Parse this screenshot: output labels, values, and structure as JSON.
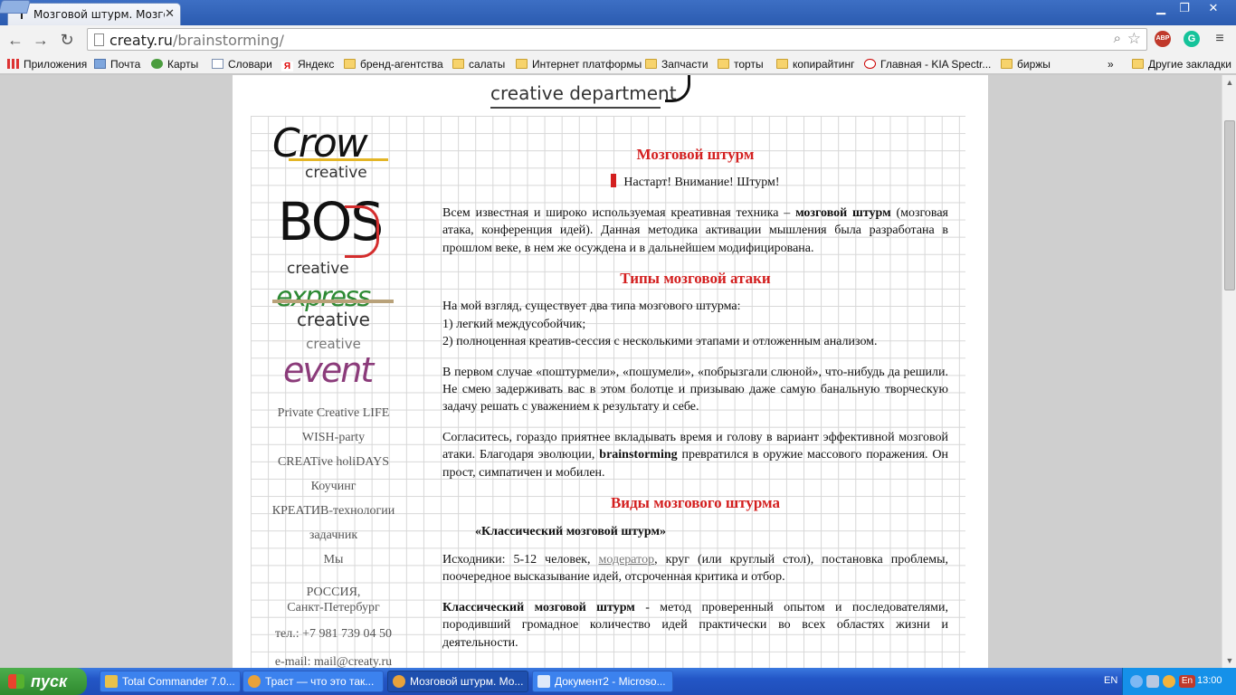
{
  "browser": {
    "tab_title": "Мозговой штурм. Мозговая",
    "url_host": "creaty.ru",
    "url_path": "/brainstorming/",
    "ext_abp": "ABP",
    "ext_grammarly": "G"
  },
  "bookmarks": [
    {
      "label": "Приложения",
      "icon": "apps-icon"
    },
    {
      "label": "Почта",
      "icon": "mail-icon"
    },
    {
      "label": "Карты",
      "icon": "maps-icon"
    },
    {
      "label": "Словари",
      "icon": "dictionary-icon"
    },
    {
      "label": "Яндекс",
      "icon": "yandex-icon"
    },
    {
      "label": "бренд-агентства",
      "icon": "folder-icon"
    },
    {
      "label": "салаты",
      "icon": "folder-icon"
    },
    {
      "label": "Интернет платформы",
      "icon": "folder-icon"
    },
    {
      "label": "Запчасти",
      "icon": "folder-icon"
    },
    {
      "label": "торты",
      "icon": "folder-icon"
    },
    {
      "label": "копирайтинг",
      "icon": "folder-icon"
    },
    {
      "label": "Главная - KIA Spectr...",
      "icon": "kia-icon"
    },
    {
      "label": "биржы",
      "icon": "folder-icon"
    }
  ],
  "bookmarks_more": "»",
  "bookmarks_other": "Другие закладки",
  "site": {
    "header_text": "creative department",
    "logos": {
      "crow_big": "Crow",
      "crow_small": "creative",
      "bos_big": "BOS",
      "bos_small": "creative",
      "express_big": "express",
      "express_small": "creative",
      "event_small": "creative",
      "event_big": "event"
    },
    "menu": [
      "Private Creative LIFE",
      "WISH-party",
      "CREATive holiDAYS",
      "Коучинг",
      "КРЕАТИВ-технологии",
      "задачник",
      "Мы"
    ],
    "country": "РОССИЯ,",
    "city": "Санкт-Петербург",
    "phone": "тел.: +7 981 739 04 50",
    "email": "e-mail: mail@creaty.ru"
  },
  "article": {
    "title": "Мозговой штурм",
    "tagline": "Настарт! Внимание! Штурм!",
    "p1_a": "Всем известная и широко используемая креативная техника – ",
    "p1_b": "мозговой штурм",
    "p1_c": " (мозговая атака, конференция идей). Данная методика активации мышления была разработана в прошлом веке, в нем же осуждена и в дальнейшем модифицирована.",
    "h2": "Типы мозговой атаки",
    "p2_l1": "На мой взгляд, существует два типа мозгового штурма:",
    "p2_l2": "1) легкий междусобойчик;",
    "p2_l3": "2) полноценная креатив-сессия с несколькими этапами и отложенным анализом.",
    "p3": "В первом случае «поштурмели», «пошумели», «побрызгали слюной», что-нибудь да решили. Не смею задерживать вас в этом болотце и призываю даже самую банальную творческую задачу решать с уважением к результату и себе.",
    "p4_a": "Согласитесь, гораздо приятнее вкладывать время и голову в вариант эффективной мозговой атаки. Благодаря эволюции, ",
    "p4_b": "brainstorming",
    "p4_c": " превратился в оружие массового поражения. Он прост, симпатичен и мобилен.",
    "h3": "Виды мозгового штурма",
    "subh": "«Классический мозговой штурм»",
    "p5_a": "Исходники: 5-12 человек, ",
    "p5_link": "модератор",
    "p5_b": ", круг (или круглый стол), постановка проблемы, поочередное высказывание идей, отсроченная критика и отбор.",
    "p6_a": "Классический мозговой штурм",
    "p6_b": " - метод проверенный опытом и последователями, породивший громадное количество идей практически во всех областях жизни и деятельности."
  },
  "taskbar": {
    "start": "пуск",
    "tasks": [
      "Total Commander 7.0...",
      "Траст — что это так...",
      "Мозговой штурм. Мо...",
      "Документ2 - Microso..."
    ],
    "lang": "EN",
    "tray_lang": "En",
    "clock": "13:00"
  },
  "colors": {
    "accent_red": "#d31f1f",
    "taskbar_blue": "#2356c6",
    "start_green": "#3a9a3a"
  }
}
